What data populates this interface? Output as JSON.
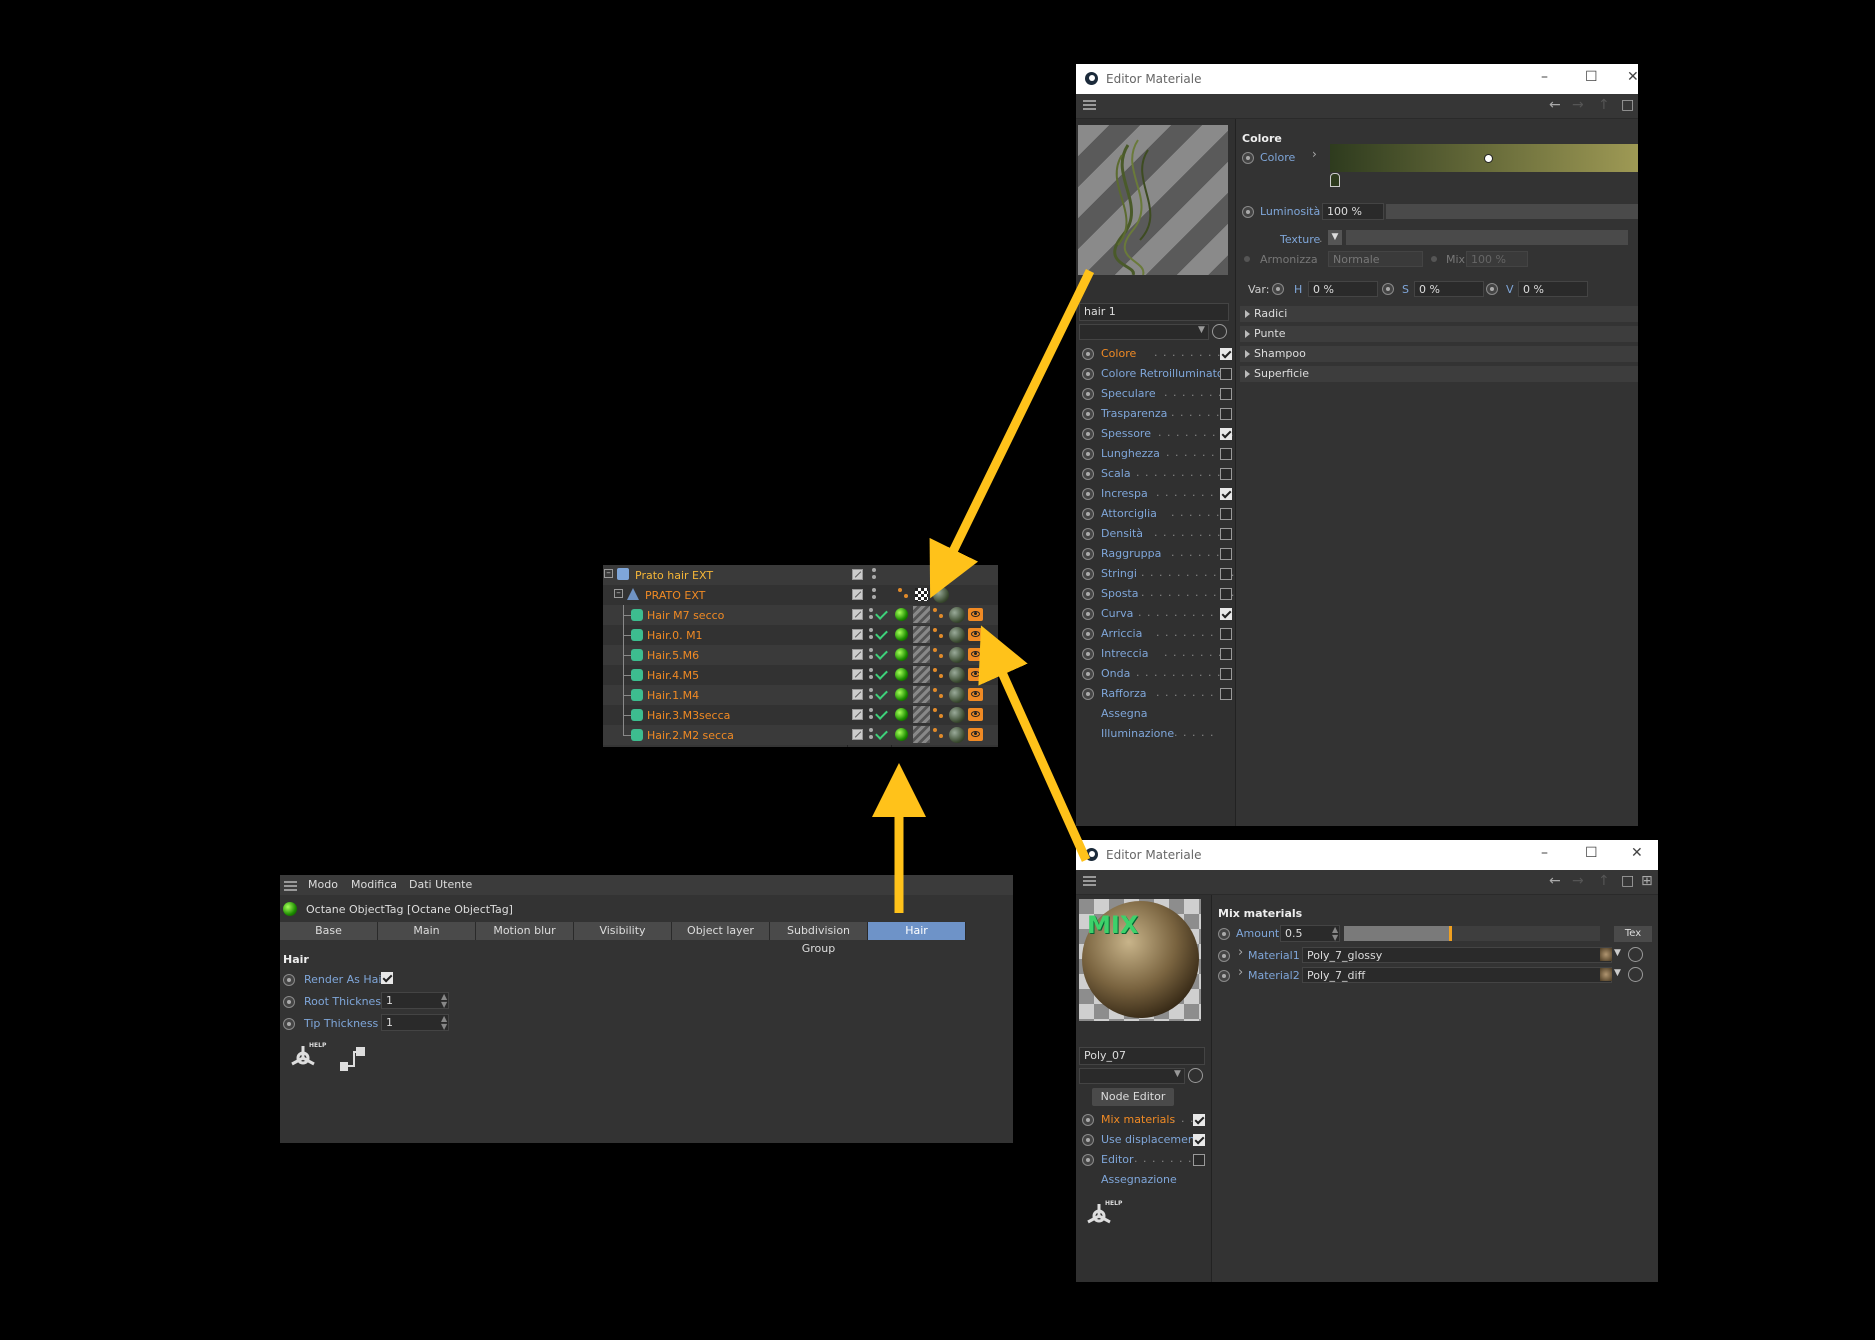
{
  "material_editor_hair": {
    "title": "Editor Materiale",
    "material_name": "hair 1",
    "section_title": "Colore",
    "colore_label": "Colore",
    "luminosita_label": "Luminosità",
    "luminosita_value": "100 %",
    "texture_label": "Texture",
    "armonizza_label": "Armonizza",
    "armonizza_value": "Normale",
    "mix_label": "Mix",
    "mix_value": "100 %",
    "var_label": "Var:",
    "h_label": "H",
    "h_value": "0 %",
    "s_label": "S",
    "s_value": "0 %",
    "v_label": "V",
    "v_value": "0 %",
    "sections": [
      "Radici",
      "Punte",
      "Shampoo",
      "Superficie"
    ],
    "channels": [
      {
        "label": "Colore",
        "checked": true,
        "active": true
      },
      {
        "label": "Colore Retroilluminato",
        "checked": false
      },
      {
        "label": "Speculare",
        "checked": false
      },
      {
        "label": "Trasparenza",
        "checked": false
      },
      {
        "label": "Spessore",
        "checked": true
      },
      {
        "label": "Lunghezza",
        "checked": false
      },
      {
        "label": "Scala",
        "checked": false
      },
      {
        "label": "Increspa",
        "checked": true
      },
      {
        "label": "Attorciglia",
        "checked": false
      },
      {
        "label": "Densità",
        "checked": false
      },
      {
        "label": "Raggruppa",
        "checked": false
      },
      {
        "label": "Stringi",
        "checked": false
      },
      {
        "label": "Sposta",
        "checked": false
      },
      {
        "label": "Curva",
        "checked": true
      },
      {
        "label": "Arriccia",
        "checked": false
      },
      {
        "label": "Intreccia",
        "checked": false
      },
      {
        "label": "Onda",
        "checked": false
      },
      {
        "label": "Rafforza",
        "checked": false
      }
    ],
    "extra_links": [
      "Assegna",
      "Illuminazione"
    ],
    "gradient_start": "#2e3b1e",
    "gradient_end": "#9f9a55"
  },
  "object_manager": {
    "root": "Prato hair  EXT",
    "child": "PRATO EXT",
    "items": [
      "Hair M7 secco",
      "Hair.0. M1",
      "Hair.5.M6",
      "Hair.4.M5",
      "Hair.1.M4",
      "Hair.3.M3secca",
      "Hair.2.M2 secca"
    ]
  },
  "tag_manager": {
    "menu": [
      "Modo",
      "Modifica",
      "Dati Utente"
    ],
    "title": "Octane ObjectTag [Octane ObjectTag]",
    "tabs": [
      "Base",
      "Main",
      "Motion blur",
      "Visibility",
      "Object layer",
      "Subdivision Group",
      "Hair"
    ],
    "active_tab": "Hair",
    "section": "Hair",
    "render_as_hair_label": "Render As Hair",
    "render_as_hair": true,
    "root_thickness_label": "Root Thickness",
    "root_thickness_value": "1",
    "tip_thickness_label": "Tip Thickness",
    "tip_thickness_value": "1",
    "help_badge": "HELP"
  },
  "material_editor_mix": {
    "title": "Editor Materiale",
    "preview_badge": "MIX",
    "section_title": "Mix materials",
    "amount_label": "Amount",
    "amount_value": "0.5",
    "amount_fraction": 0.5,
    "tex_button": "Tex",
    "material1_label": "Material1",
    "material1_value": "Poly_7_glossy",
    "material2_label": "Material2",
    "material2_value": "Poly_7_diff",
    "material_name": "Poly_07",
    "node_editor_button": "Node Editor",
    "channels": [
      {
        "label": "Mix materials",
        "checked": true,
        "active": true
      },
      {
        "label": "Use displacement",
        "checked": true
      },
      {
        "label": "Editor",
        "checked": false
      }
    ],
    "assign_link": "Assegnazione",
    "help_badge": "HELP"
  },
  "colors": {
    "accent_orange": "#f08a24",
    "link_blue": "#7fa6d9",
    "active_tab": "#6e93c8",
    "arrow_yellow": "#ffc21a"
  }
}
